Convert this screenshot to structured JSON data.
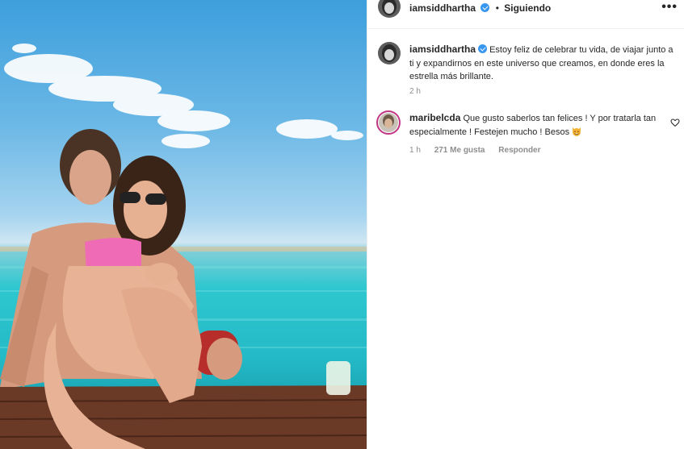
{
  "post": {
    "author": "iamsiddhartha",
    "follow_dot": "•",
    "follow_label": "Siguiendo",
    "more_icon": "more-horizontal-icon"
  },
  "caption": {
    "username": "iamsiddhartha",
    "text": "Estoy feliz de celebrar tu vida, de viajar junto a ti y expandirnos en este universo que creamos, en donde eres la estrella más brillante.",
    "time": "2 h"
  },
  "comment": {
    "username": "maribelcda",
    "text": "Que gusto saberlos tan felices ! Y por tratarla tan especialmente ! Festejen mucho ! Besos",
    "emoji": "smiling-cat-emoji",
    "time": "1 h",
    "likes": "271 Me gusta",
    "reply_label": "Responder"
  },
  "colors": {
    "verified_badge": "#3897f0",
    "meta_text": "#8e8e8e"
  }
}
